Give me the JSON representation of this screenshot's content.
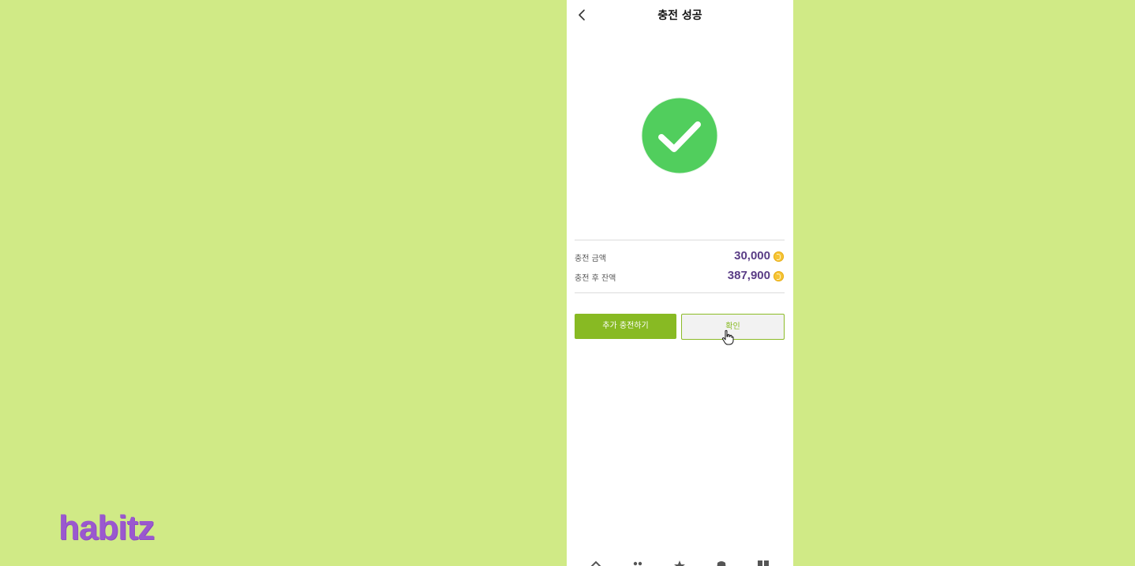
{
  "brand": {
    "logo_text": "habitz",
    "logo_color": "#9a58cf"
  },
  "colors": {
    "background": "#d0ea86",
    "primary": "#88ba23",
    "success": "#51ce5d",
    "amount": "#5a3d86",
    "coin": "#f6c435"
  },
  "header": {
    "title": "충전 성공",
    "back_icon": "chevron-left-icon"
  },
  "success": {
    "icon": "check-circle-icon"
  },
  "summary": {
    "rows": [
      {
        "label": "충전 금액",
        "value": "30,000",
        "icon": "coin-icon"
      },
      {
        "label": "충전 후 잔액",
        "value": "387,900",
        "icon": "coin-icon"
      }
    ]
  },
  "actions": {
    "charge_more_label": "추가 충전하기",
    "confirm_label": "확인"
  },
  "tabbar": {
    "items": [
      "home-icon",
      "people-icon",
      "star-icon",
      "shop-icon",
      "grid-icon"
    ]
  }
}
